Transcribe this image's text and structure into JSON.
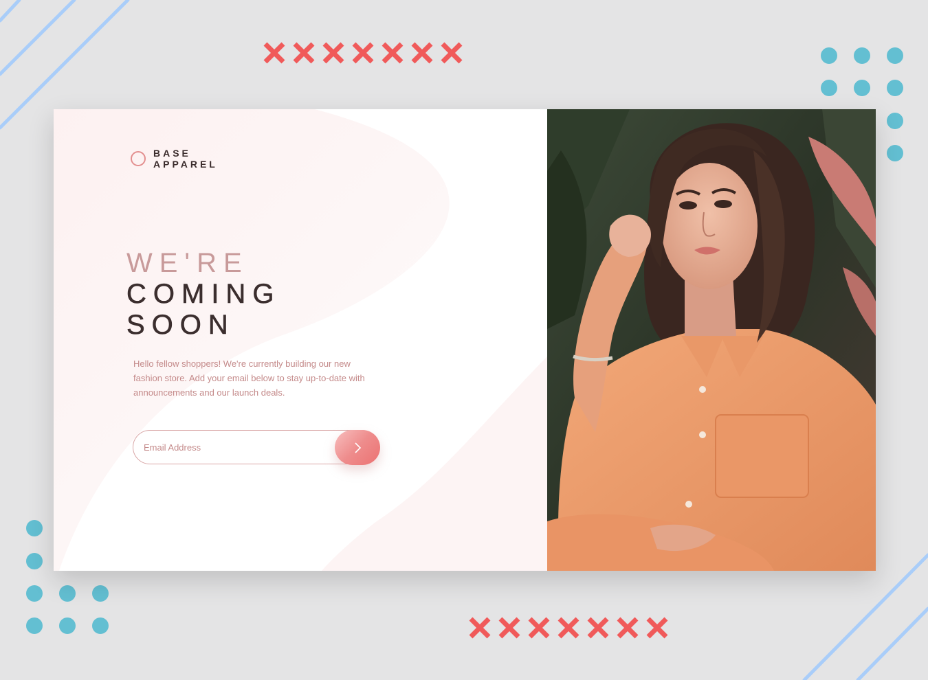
{
  "brand": {
    "line1": "BASE",
    "line2": "APPAREL"
  },
  "headline": {
    "line1": "WE'RE",
    "line2": "COMING",
    "line3": "SOON"
  },
  "description": "Hello fellow shoppers! We're currently building our new fashion store. Add your email below to stay up-to-date with announcements and our launch deals.",
  "email": {
    "placeholder": "Email Address",
    "submit_icon": "chevron-right-icon"
  },
  "hero": {
    "image": "woman-orange-shirt-photo"
  },
  "colors": {
    "background": "#e4e4e5",
    "accent_pink": "#ec7272",
    "soft_pink": "#c48a8a",
    "dark_text": "#3b2e2e",
    "dots": "#63bfd2",
    "crosses": "#f05a5a",
    "stripes": "#a9cdf9"
  }
}
